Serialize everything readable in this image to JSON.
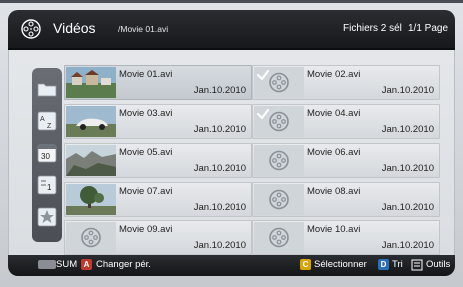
{
  "header": {
    "title": "Vidéos",
    "path": "/Movie 01.avi",
    "selection": "Fichiers 2 sél",
    "page": "1/1 Page"
  },
  "sidebar": {
    "items": [
      {
        "name": "folder-view",
        "icon": "folder-icon"
      },
      {
        "name": "title-sort",
        "icon": "az-sort-icon"
      },
      {
        "name": "date-sort",
        "icon": "calendar-30-icon"
      },
      {
        "name": "list-view",
        "icon": "list-1-icon"
      },
      {
        "name": "favorites",
        "icon": "star-icon"
      }
    ]
  },
  "files": [
    {
      "name": "Movie 01.avi",
      "date": "Jan.10.2010",
      "thumb": "photo-houses",
      "checked": false,
      "active": true
    },
    {
      "name": "Movie 02.avi",
      "date": "Jan.10.2010",
      "thumb": "generic-video",
      "checked": true,
      "active": false
    },
    {
      "name": "Movie 03.avi",
      "date": "Jan.10.2010",
      "thumb": "photo-car",
      "checked": false,
      "active": false
    },
    {
      "name": "Movie 04.avi",
      "date": "Jan.10.2010",
      "thumb": "generic-video",
      "checked": true,
      "active": false
    },
    {
      "name": "Movie 05.avi",
      "date": "Jan.10.2010",
      "thumb": "photo-rocks",
      "checked": false,
      "active": false
    },
    {
      "name": "Movie 06.avi",
      "date": "Jan.10.2010",
      "thumb": "generic-video",
      "checked": false,
      "active": false
    },
    {
      "name": "Movie 07.avi",
      "date": "Jan.10.2010",
      "thumb": "photo-tree",
      "checked": false,
      "active": false
    },
    {
      "name": "Movie 08.avi",
      "date": "Jan.10.2010",
      "thumb": "generic-video",
      "checked": false,
      "active": false
    },
    {
      "name": "Movie 09.avi",
      "date": "Jan.10.2010",
      "thumb": "generic-video",
      "checked": false,
      "active": false
    },
    {
      "name": "Movie 10.avi",
      "date": "Jan.10.2010",
      "thumb": "generic-video",
      "checked": false,
      "active": false
    }
  ],
  "footer": {
    "sum_label": "SUM",
    "a_key": "A",
    "a_label": "Changer pér.",
    "c_key": "C",
    "c_label": "Sélectionner",
    "d_key": "D",
    "d_label": "Tri",
    "tools_label": "Outils"
  },
  "colors": {
    "key_a": "#c0392b",
    "key_c": "#d9a400",
    "key_d": "#2a6fb5"
  }
}
